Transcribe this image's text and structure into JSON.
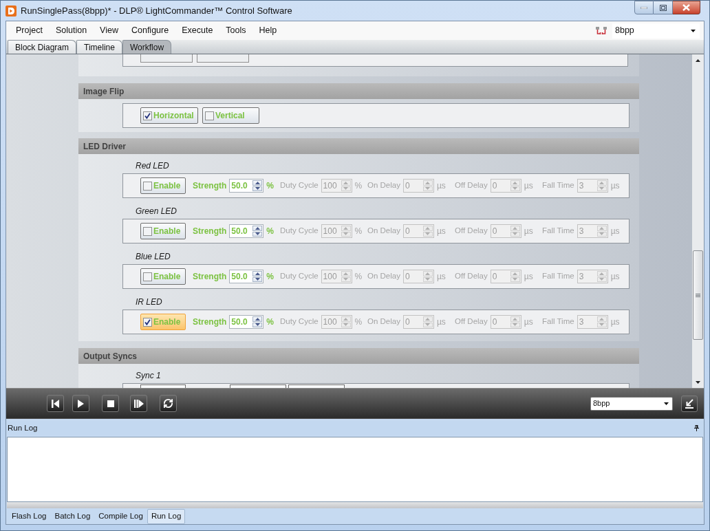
{
  "window": {
    "title": "RunSinglePass(8bpp)* - DLP® LightCommander™ Control Software"
  },
  "menu_bar": {
    "items": [
      "Project",
      "Solution",
      "View",
      "Configure",
      "Execute",
      "Tools",
      "Help"
    ],
    "configuration": "8bpp"
  },
  "view_tabs": [
    {
      "label": "Block Diagram",
      "selected": false
    },
    {
      "label": "Timeline",
      "selected": false
    },
    {
      "label": "Workflow",
      "selected": true
    }
  ],
  "sections": [
    {
      "kind": "flip",
      "title": "Image Flip",
      "options": [
        {
          "label": "Horizontal",
          "checked": true
        },
        {
          "label": "Vertical",
          "checked": false
        }
      ]
    },
    {
      "kind": "led",
      "title": "LED Driver",
      "leds": [
        {
          "name": "Red LED",
          "enable": {
            "label": "Enable",
            "checked": false,
            "focused": false
          },
          "fields": [
            {
              "label": "Strength",
              "value": "50.0",
              "unit": "%",
              "disabled": false
            },
            {
              "label": "Duty Cycle",
              "value": "100",
              "unit": "%",
              "disabled": true
            },
            {
              "label": "On Delay",
              "value": "0",
              "unit": "µs",
              "disabled": true
            },
            {
              "label": "Off Delay",
              "value": "0",
              "unit": "µs",
              "disabled": true
            },
            {
              "label": "Fall Time",
              "value": "3",
              "unit": "µs",
              "disabled": true
            }
          ]
        },
        {
          "name": "Green LED",
          "enable": {
            "label": "Enable",
            "checked": false,
            "focused": false
          },
          "fields": [
            {
              "label": "Strength",
              "value": "50.0",
              "unit": "%",
              "disabled": false
            },
            {
              "label": "Duty Cycle",
              "value": "100",
              "unit": "%",
              "disabled": true
            },
            {
              "label": "On Delay",
              "value": "0",
              "unit": "µs",
              "disabled": true
            },
            {
              "label": "Off Delay",
              "value": "0",
              "unit": "µs",
              "disabled": true
            },
            {
              "label": "Fall Time",
              "value": "3",
              "unit": "µs",
              "disabled": true
            }
          ]
        },
        {
          "name": "Blue LED",
          "enable": {
            "label": "Enable",
            "checked": false,
            "focused": false
          },
          "fields": [
            {
              "label": "Strength",
              "value": "50.0",
              "unit": "%",
              "disabled": false
            },
            {
              "label": "Duty Cycle",
              "value": "100",
              "unit": "%",
              "disabled": true
            },
            {
              "label": "On Delay",
              "value": "0",
              "unit": "µs",
              "disabled": true
            },
            {
              "label": "Off Delay",
              "value": "0",
              "unit": "µs",
              "disabled": true
            },
            {
              "label": "Fall Time",
              "value": "3",
              "unit": "µs",
              "disabled": true
            }
          ]
        },
        {
          "name": "IR LED",
          "enable": {
            "label": "Enable",
            "checked": true,
            "focused": true
          },
          "fields": [
            {
              "label": "Strength",
              "value": "50.0",
              "unit": "%",
              "disabled": false
            },
            {
              "label": "Duty Cycle",
              "value": "100",
              "unit": "%",
              "disabled": true
            },
            {
              "label": "On Delay",
              "value": "0",
              "unit": "µs",
              "disabled": true
            },
            {
              "label": "Off Delay",
              "value": "0",
              "unit": "µs",
              "disabled": true
            },
            {
              "label": "Fall Time",
              "value": "3",
              "unit": "µs",
              "disabled": true
            }
          ]
        }
      ]
    },
    {
      "kind": "sync",
      "title": "Output Syncs",
      "syncs": [
        {
          "name": "Sync 1"
        }
      ]
    }
  ],
  "run_toolbar": {
    "configuration": "8bpp"
  },
  "log_panel": {
    "title": "Run Log",
    "tabs": [
      {
        "label": "Flash Log",
        "selected": false
      },
      {
        "label": "Batch Log",
        "selected": false
      },
      {
        "label": "Compile Log",
        "selected": false
      },
      {
        "label": "Run Log",
        "selected": true
      }
    ]
  }
}
